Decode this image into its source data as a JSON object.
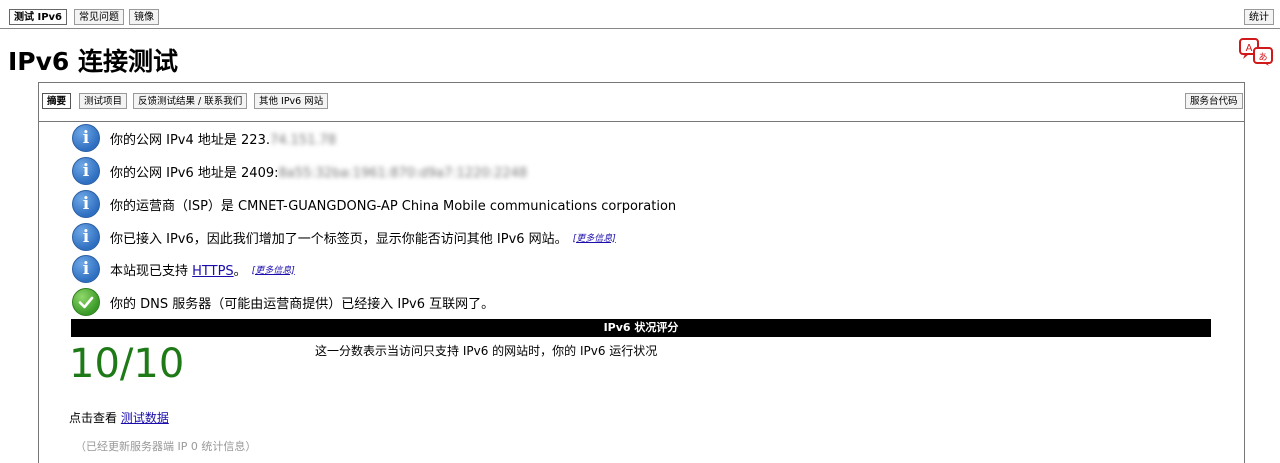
{
  "top_tabs": [
    {
      "label": "测试 IPv6",
      "active": true
    },
    {
      "label": "常见问题"
    },
    {
      "label": "镜像"
    }
  ],
  "stats_tab": "统计",
  "page_title": "IPv6 连接测试",
  "sub_tabs": [
    {
      "label": "摘要",
      "active": true
    },
    {
      "label": "测试项目"
    },
    {
      "label": "反馈测试结果 / 联系我们"
    },
    {
      "label": "其他 IPv6 网站"
    }
  ],
  "helpdesk_tab": "服务台代码",
  "results": {
    "ipv4": {
      "text": "你的公网 IPv4 地址是 223.",
      "blurred": "74.151.78"
    },
    "ipv6": {
      "text": "你的公网 IPv6 地址是 2409:",
      "blurred": "8a55:32ba:1961:870:d9a7:1220:2248"
    },
    "isp": "你的运营商（ISP）是 CMNET-GUANGDONG-AP China Mobile communications corporation",
    "ipv6_tab_text": "你已接入 IPv6，因此我们增加了一个标签页，显示你能否访问其他 IPv6 网站。",
    "https_before": "本站现已支持 ",
    "https_link": "HTTPS",
    "https_after": "。",
    "dns": "你的 DNS 服务器（可能由运营商提供）已经接入 IPv6 互联网了。",
    "more_info": "[更多信息]"
  },
  "score_header": "IPv6 状况评分",
  "score": "10/10",
  "score_description": "这一分数表示当访问只支持 IPv6 的网站时，你的 IPv6 运行状况",
  "view_data_prefix": "点击查看 ",
  "view_data_link": "测试数据",
  "cut_text": "（已经更新服务器端 IP 0 统计信息）",
  "icons": [
    "info-icon",
    "check-icon",
    "translate-icon"
  ],
  "colors": {
    "score_green": "#1d7a16",
    "info_blue": "#2f6fc1",
    "check_green": "#3a9a28"
  }
}
